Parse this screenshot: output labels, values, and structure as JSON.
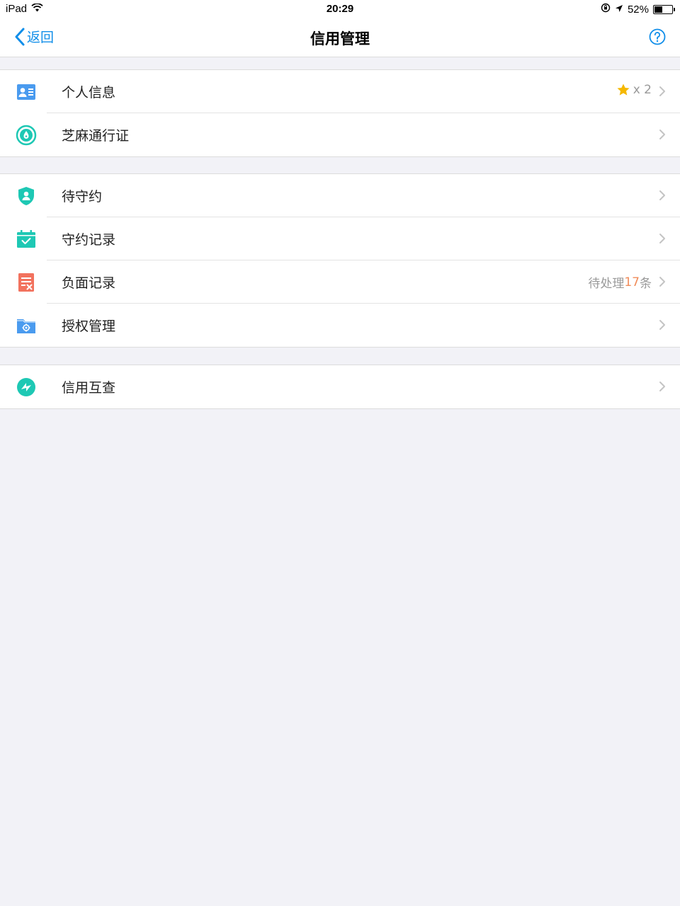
{
  "status_bar": {
    "device": "iPad",
    "time": "20:29",
    "battery": "52%",
    "battery_level": 0.52
  },
  "nav": {
    "back_label": "返回",
    "title": "信用管理"
  },
  "groups": [
    {
      "rows": [
        {
          "label": "个人信息",
          "icon": "id-card-icon",
          "extra_text": "x 2",
          "extra_icon": "star-icon"
        },
        {
          "label": "芝麻通行证",
          "icon": "sesame-pass-icon"
        }
      ]
    },
    {
      "rows": [
        {
          "label": "待守约",
          "icon": "shield-user-icon"
        },
        {
          "label": "守约记录",
          "icon": "calendar-check-icon"
        },
        {
          "label": "负面记录",
          "icon": "negative-record-icon",
          "extra_prefix": "待处理",
          "extra_count": "17",
          "extra_suffix": "条"
        },
        {
          "label": "授权管理",
          "icon": "folder-gear-icon"
        }
      ]
    },
    {
      "rows": [
        {
          "label": "信用互查",
          "icon": "credit-check-icon"
        }
      ]
    }
  ],
  "colors": {
    "accent": "#108ee9",
    "teal": "#1ec8b4",
    "red": "#f2725e",
    "blue": "#4a9bef",
    "star": "#f5b800",
    "count": "#f08c5a"
  }
}
